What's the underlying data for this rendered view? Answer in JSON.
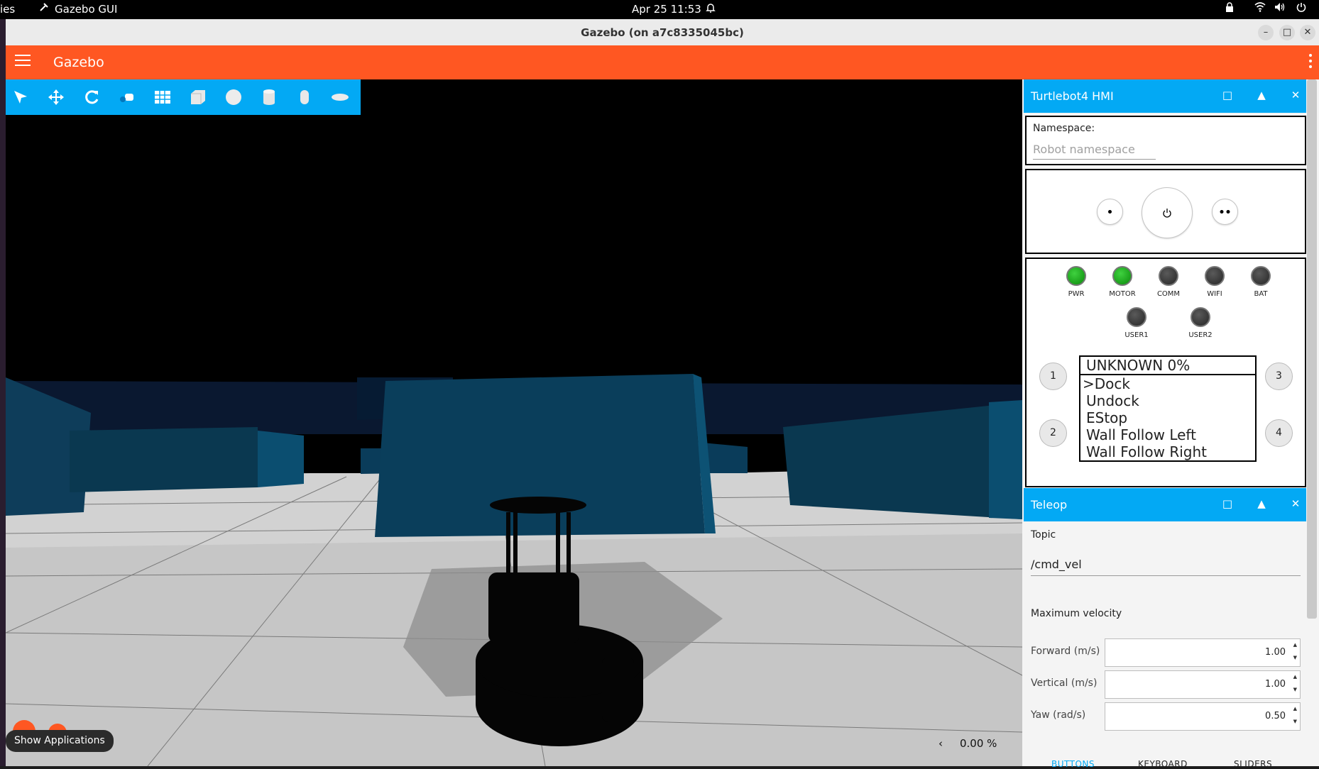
{
  "topbar": {
    "activities": "ies",
    "app_name": "Gazebo GUI",
    "datetime": "Apr 25  11:53"
  },
  "window": {
    "title": "Gazebo (on a7c8335045bc)"
  },
  "app": {
    "title": "Gazebo"
  },
  "scene": {
    "sim_time": "0.00 %",
    "show_applications": "Show Applications"
  },
  "hmi": {
    "title": "Turtlebot4 HMI",
    "namespace_label": "Namespace:",
    "namespace_placeholder": "Robot namespace",
    "leds": [
      {
        "label": "PWR",
        "state": "on"
      },
      {
        "label": "MOTOR",
        "state": "on"
      },
      {
        "label": "COMM",
        "state": "off"
      },
      {
        "label": "WIFI",
        "state": "off"
      },
      {
        "label": "BAT",
        "state": "off"
      }
    ],
    "user_leds": [
      {
        "label": "USER1",
        "state": "off"
      },
      {
        "label": "USER2",
        "state": "off"
      }
    ],
    "buttons": [
      "1",
      "2",
      "3",
      "4"
    ],
    "display": {
      "header": "UNKNOWN 0%",
      "lines": [
        ">Dock",
        "Undock",
        "EStop",
        "Wall Follow Left",
        "Wall Follow Right"
      ]
    },
    "colors": {
      "led_on": "#0a8a0a",
      "led_off": "#2a2a2a"
    }
  },
  "teleop": {
    "title": "Teleop",
    "topic_label": "Topic",
    "topic_value": "/cmd_vel",
    "max_velocity_label": "Maximum velocity",
    "fields": [
      {
        "label": "Forward (m/s)",
        "value": "1.00"
      },
      {
        "label": "Vertical (m/s)",
        "value": "1.00"
      },
      {
        "label": "Yaw (rad/s)",
        "value": "0.50"
      }
    ],
    "tabs": [
      "BUTTONS",
      "KEYBOARD",
      "SLIDERS"
    ]
  },
  "colors": {
    "accent": "#ff5722",
    "panel_header": "#03a9f4"
  }
}
